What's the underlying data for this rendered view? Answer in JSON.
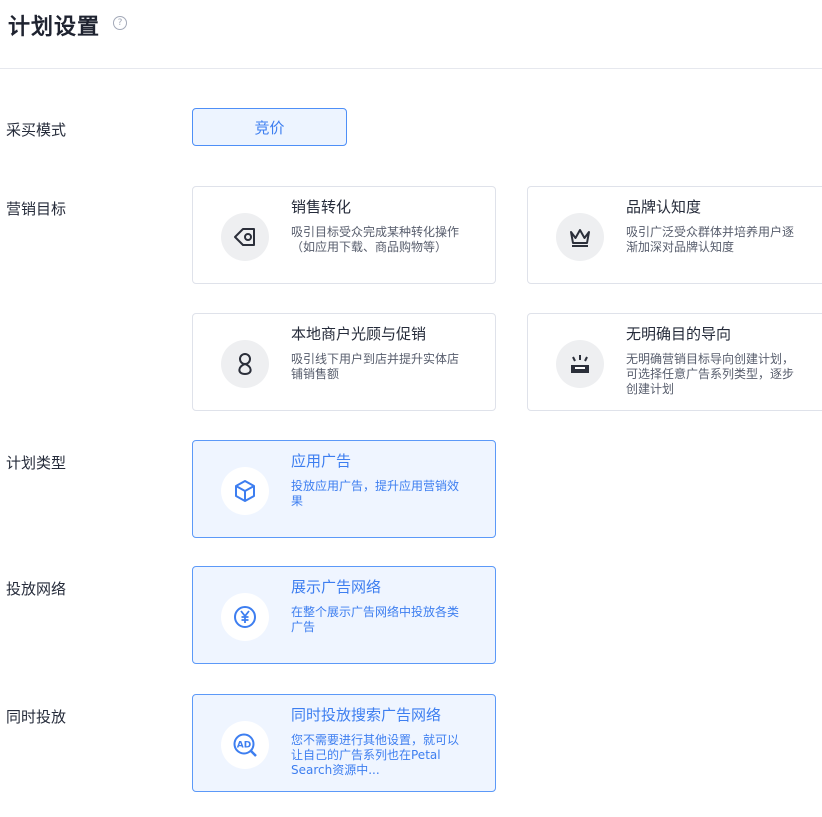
{
  "header": {
    "title": "计划设置",
    "help_icon": "question-circle-icon"
  },
  "rows": {
    "purchase_mode": {
      "label": "采买模式",
      "option": "竞价"
    },
    "marketing_goal": {
      "label": "营销目标",
      "cards": [
        {
          "title": "销售转化",
          "desc": "吸引目标受众完成某种转化操作（如应用下载、商品购物等）",
          "icon": "tag-icon"
        },
        {
          "title": "品牌认知度",
          "desc": "吸引广泛受众群体并培养用户逐渐加深对品牌认知度",
          "icon": "crown-icon"
        },
        {
          "title": "本地商户光顾与促销",
          "desc": "吸引线下用户到店并提升实体店铺销售额",
          "icon": "location-pin-icon"
        },
        {
          "title": "无明确目的导向",
          "desc": "无明确营销目标导向创建计划，可选择任意广告系列类型，逐步创建计划",
          "icon": "inbox-sparkle-icon"
        }
      ]
    },
    "plan_type": {
      "label": "计划类型",
      "card": {
        "title": "应用广告",
        "desc": "投放应用广告，提升应用营销效果",
        "icon": "cube-icon"
      }
    },
    "network": {
      "label": "投放网络",
      "card": {
        "title": "展示广告网络",
        "desc": "在整个展示广告网络中投放各类广告",
        "icon": "yen-circle-icon"
      }
    },
    "simultaneous": {
      "label": "同时投放",
      "card": {
        "title": "同时投放搜索广告网络",
        "desc": "您不需要进行其他设置，就可以让自己的广告系列也在Petal Search资源中...",
        "icon": "ad-search-icon"
      }
    }
  },
  "colors": {
    "accent": "#3d7ef0",
    "selected_bg": "#eff5ff",
    "border": "#dfe2ea"
  }
}
